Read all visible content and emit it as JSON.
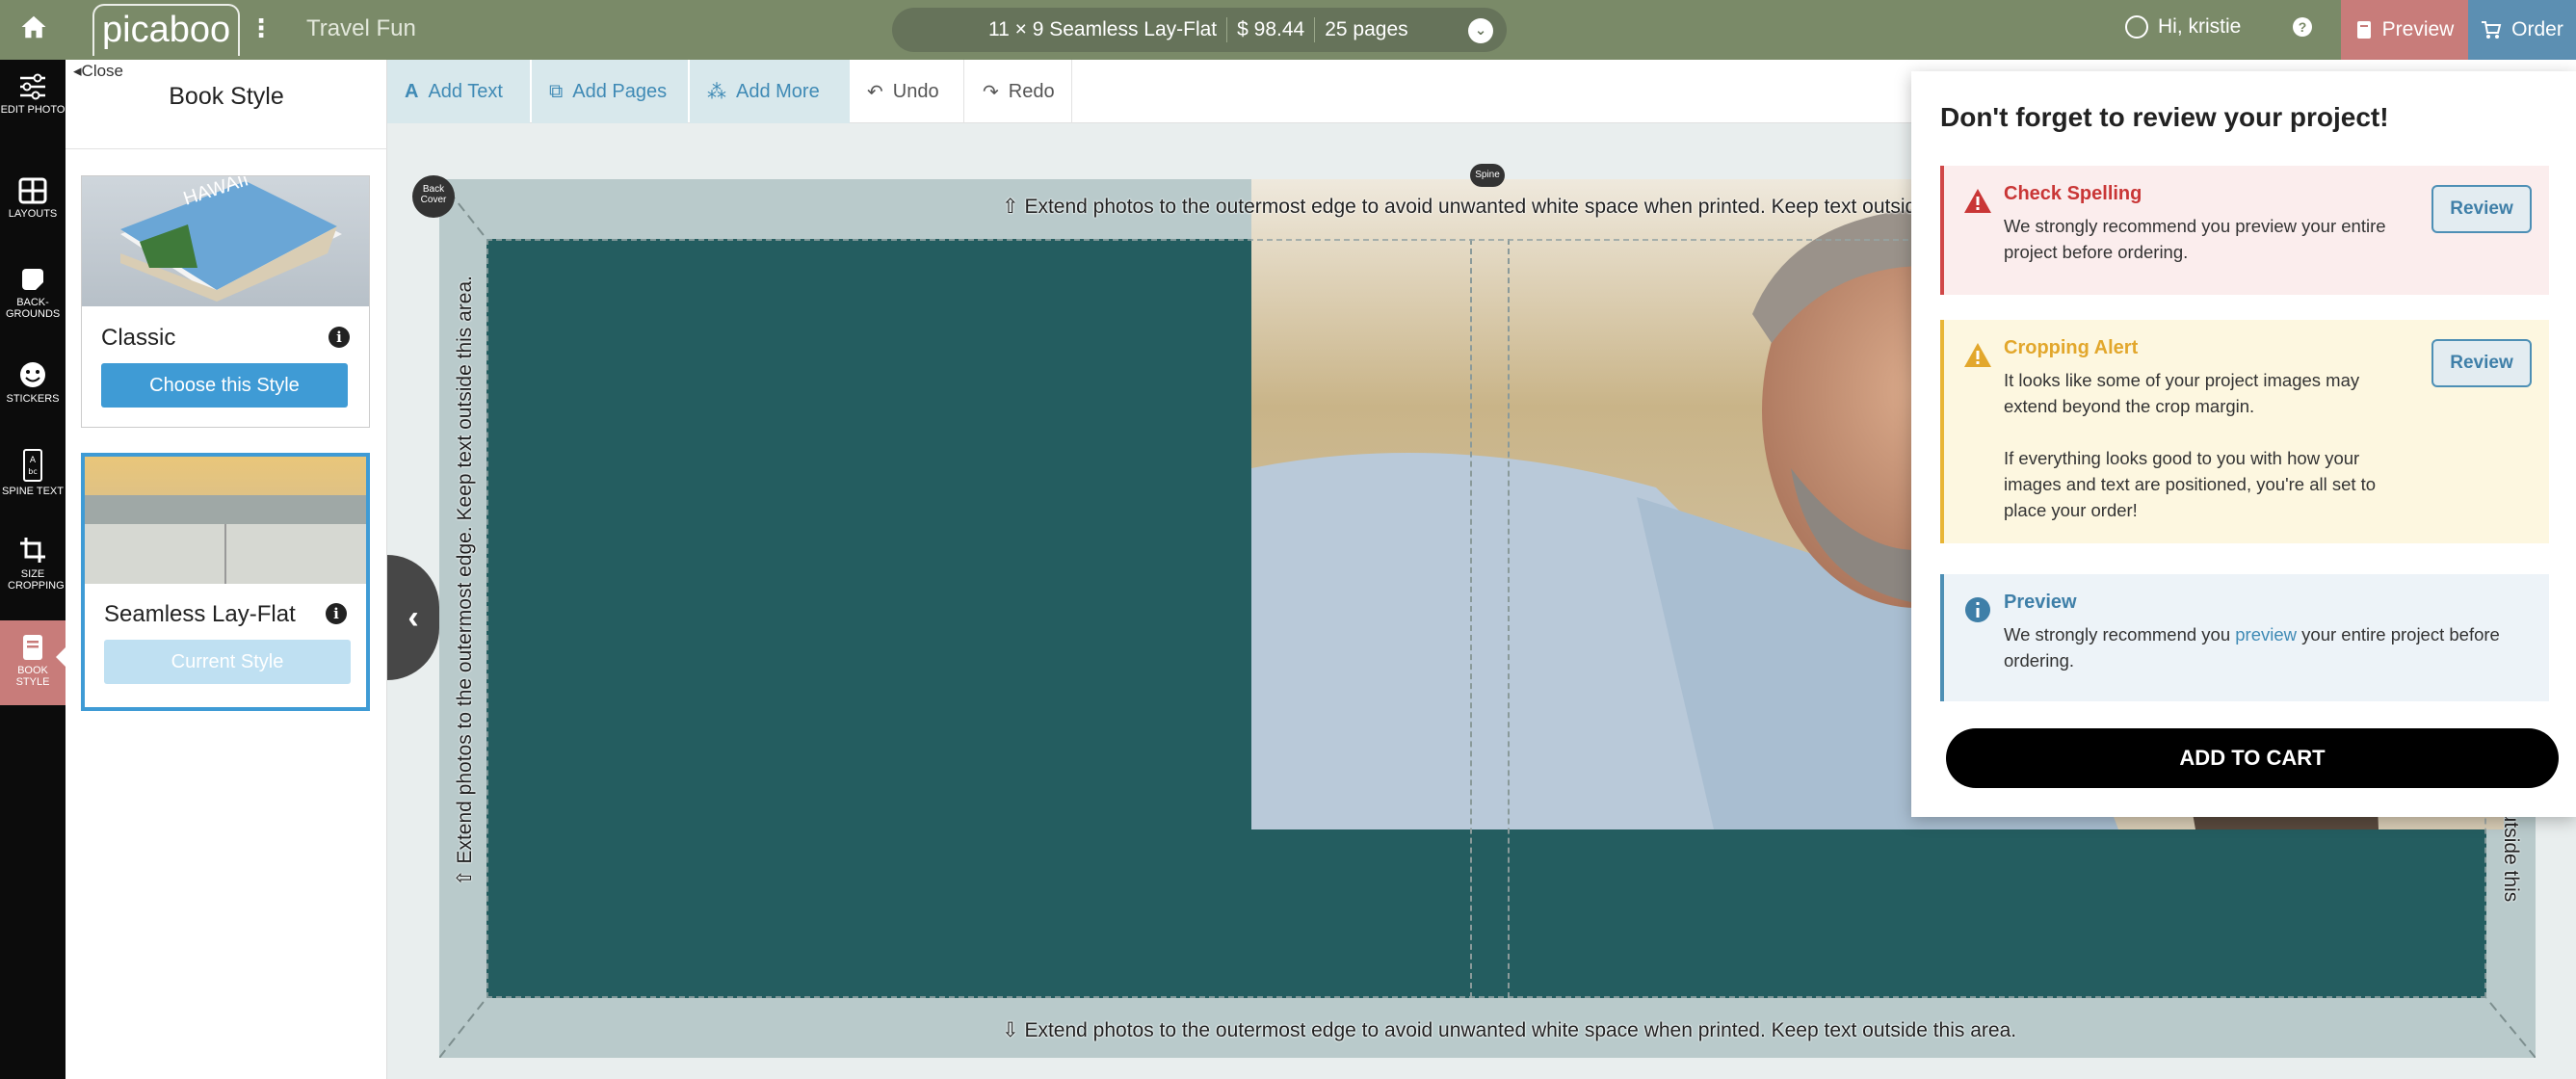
{
  "topbar": {
    "logo": "picaboo",
    "project_title": "Travel Fun",
    "book_size": "11 × 9 Seamless Lay-Flat",
    "price": "$ 98.44",
    "pages": "25 pages",
    "greeting": "Hi, kristie",
    "help": "?",
    "preview_label": "Preview",
    "order_label": "Order",
    "colors": {
      "bar": "#7a8a68",
      "preview": "#c87c7a",
      "order": "#5c8fb2"
    }
  },
  "tools": [
    {
      "label": "EDIT PHOTO",
      "icon": "sliders-icon"
    },
    {
      "label": "LAYOUTS",
      "icon": "grid-icon"
    },
    {
      "label": "BACK-GROUNDS",
      "icon": "background-icon"
    },
    {
      "label": "STICKERS",
      "icon": "smiley-icon"
    },
    {
      "label": "SPINE TEXT",
      "icon": "spine-text-icon"
    },
    {
      "label": "SIZE CROPPING",
      "icon": "crop-icon"
    },
    {
      "label": "BOOK STYLE",
      "icon": "book-icon"
    }
  ],
  "panel": {
    "close_label": "Close",
    "title": "Book Style",
    "styles": [
      {
        "name": "Classic",
        "button": "Choose this Style",
        "thumb_text": "HAWAII"
      },
      {
        "name": "Seamless Lay-Flat",
        "button": "Current Style"
      }
    ]
  },
  "toolbar": {
    "add_text": "Add Text",
    "add_pages": "Add Pages",
    "add_more": "Add More",
    "undo": "Undo",
    "redo": "Redo"
  },
  "canvas": {
    "back_cover": "Back Cover",
    "spine": "Spine",
    "bleed_top": "Extend photos to the outermost edge to avoid unwanted white space when printed. Keep text outside this",
    "bleed_bottom": "Extend photos to the outermost edge to avoid unwanted white space when printed. Keep text outside this area.",
    "bleed_left": "Extend photos to the outermost edge. Keep text outside this area.",
    "bleed_right": "outside this",
    "page_color": "#245d60"
  },
  "review": {
    "title": "Don't forget to review your project!",
    "items": [
      {
        "heading": "Check Spelling",
        "body": "We strongly recommend you preview your entire project before ordering.",
        "button": "Review"
      },
      {
        "heading": "Cropping Alert",
        "body1": "It looks like some of your project images may extend beyond the crop margin.",
        "body2": "If everything looks good to you with how your images and text are positioned, you're all set to place your order!",
        "button": "Review"
      },
      {
        "heading": "Preview",
        "body_pre": "We strongly recommend you ",
        "body_link": "preview",
        "body_post": " your entire project before ordering."
      }
    ],
    "cart_label": "ADD TO CART"
  }
}
